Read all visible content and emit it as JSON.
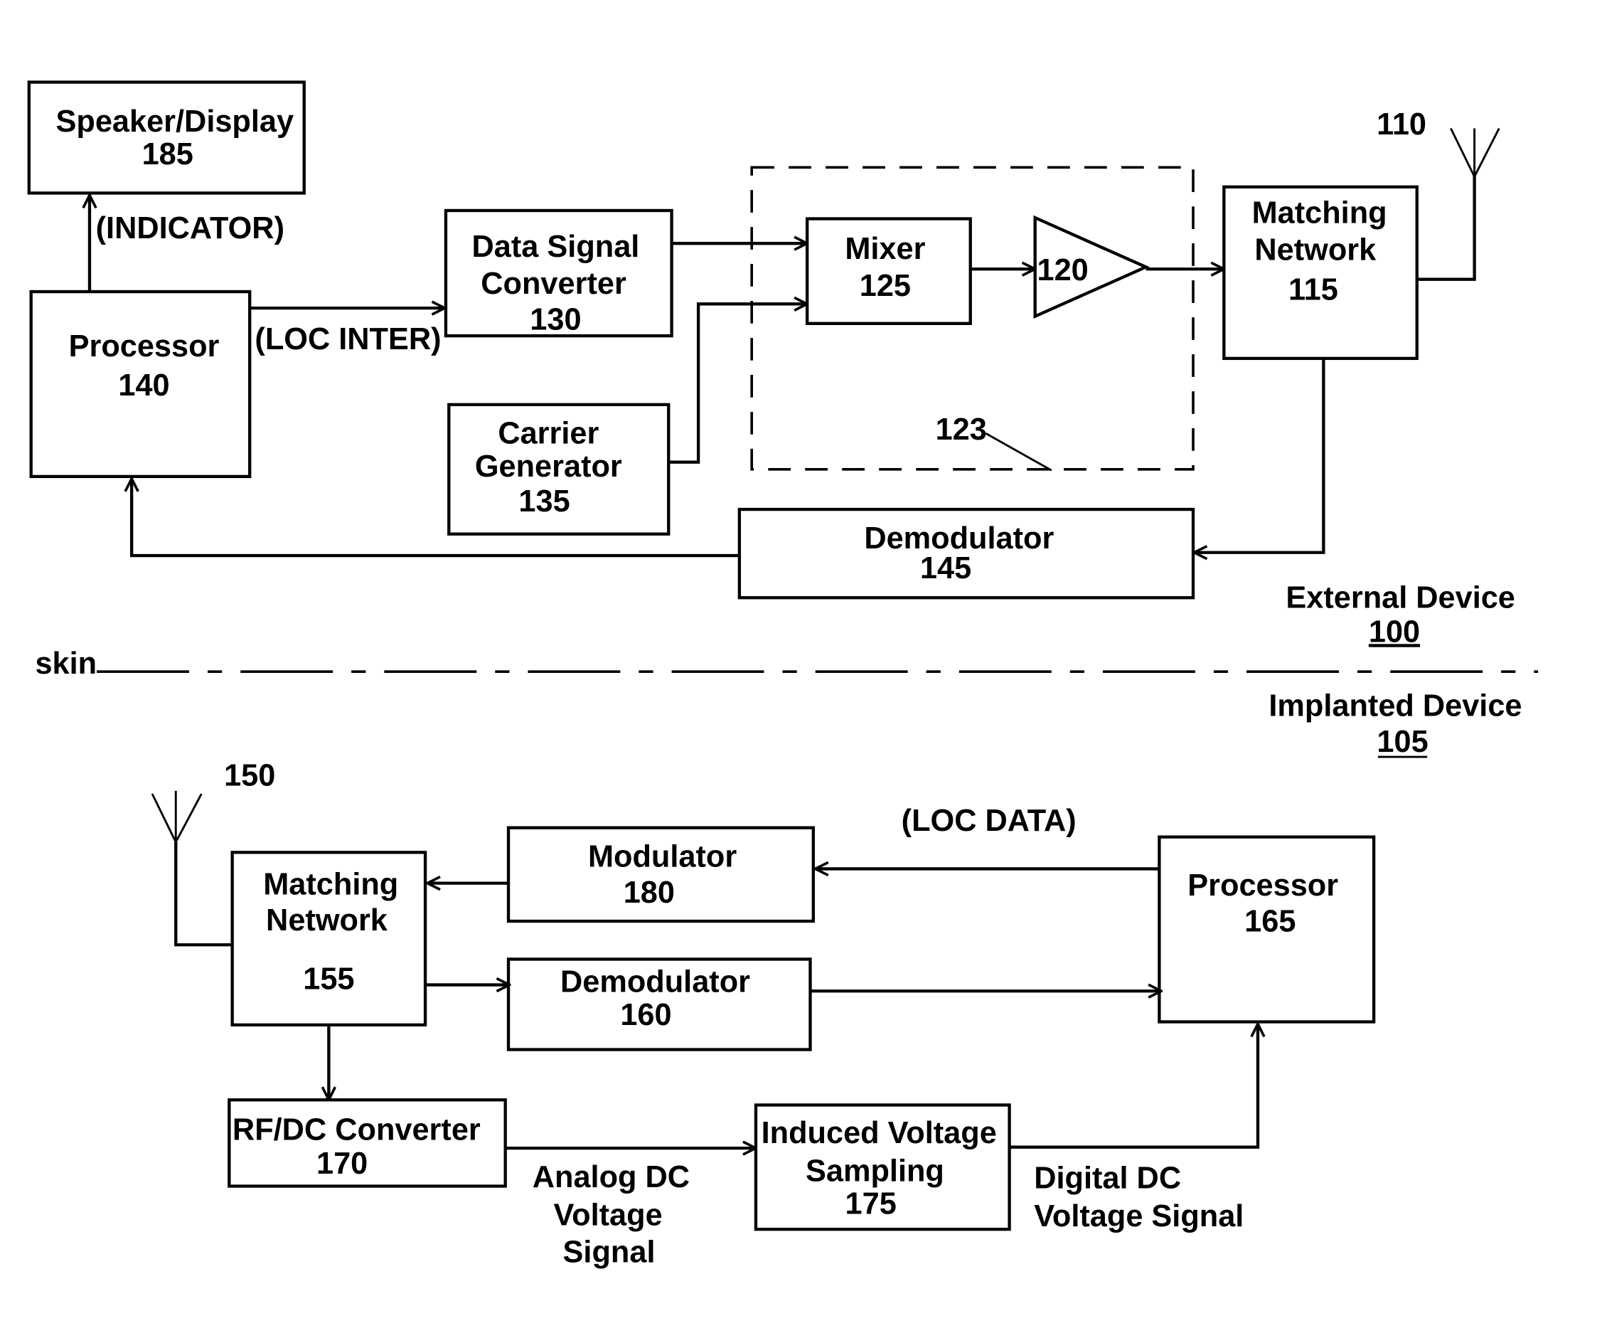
{
  "diagram": {
    "external_device": {
      "label": "External Device",
      "ref": "100"
    },
    "implanted_device": {
      "label": "Implanted Device",
      "ref": "105"
    },
    "skin_label": "skin",
    "blocks": {
      "speaker_display": {
        "name": "Speaker/Display",
        "ref": "185"
      },
      "processor_140": {
        "name": "Processor",
        "ref": "140"
      },
      "data_signal_converter": {
        "line1": "Data Signal",
        "line2": "Converter",
        "ref": "130"
      },
      "carrier_generator": {
        "line1": "Carrier",
        "line2": "Generator",
        "ref": "135"
      },
      "mixer": {
        "name": "Mixer",
        "ref": "125"
      },
      "amplifier": {
        "ref": "120"
      },
      "transmitter_group": {
        "ref": "123"
      },
      "matching_network_115": {
        "line1": "Matching",
        "line2": "Network",
        "ref": "115"
      },
      "antenna_110": {
        "ref": "110"
      },
      "demodulator_145": {
        "name": "Demodulator",
        "ref": "145"
      },
      "antenna_150": {
        "ref": "150"
      },
      "matching_network_155": {
        "line1": "Matching",
        "line2": "Network",
        "ref": "155"
      },
      "modulator_180": {
        "name": "Modulator",
        "ref": "180"
      },
      "demodulator_160": {
        "name": "Demodulator",
        "ref": "160"
      },
      "processor_165": {
        "name": "Processor",
        "ref": "165"
      },
      "rf_dc_converter": {
        "name": "RF/DC Converter",
        "ref": "170"
      },
      "induced_voltage_sampling": {
        "line1": "Induced Voltage",
        "line2": "Sampling",
        "ref": "175"
      }
    },
    "signals": {
      "indicator": "(INDICATOR)",
      "loc_inter": "(LOC INTER)",
      "loc_data": "(LOC DATA)",
      "analog": {
        "line1": "Analog DC",
        "line2": "Voltage",
        "line3": "Signal"
      },
      "digital": {
        "line1": "Digital DC",
        "line2": "Voltage Signal"
      }
    }
  }
}
